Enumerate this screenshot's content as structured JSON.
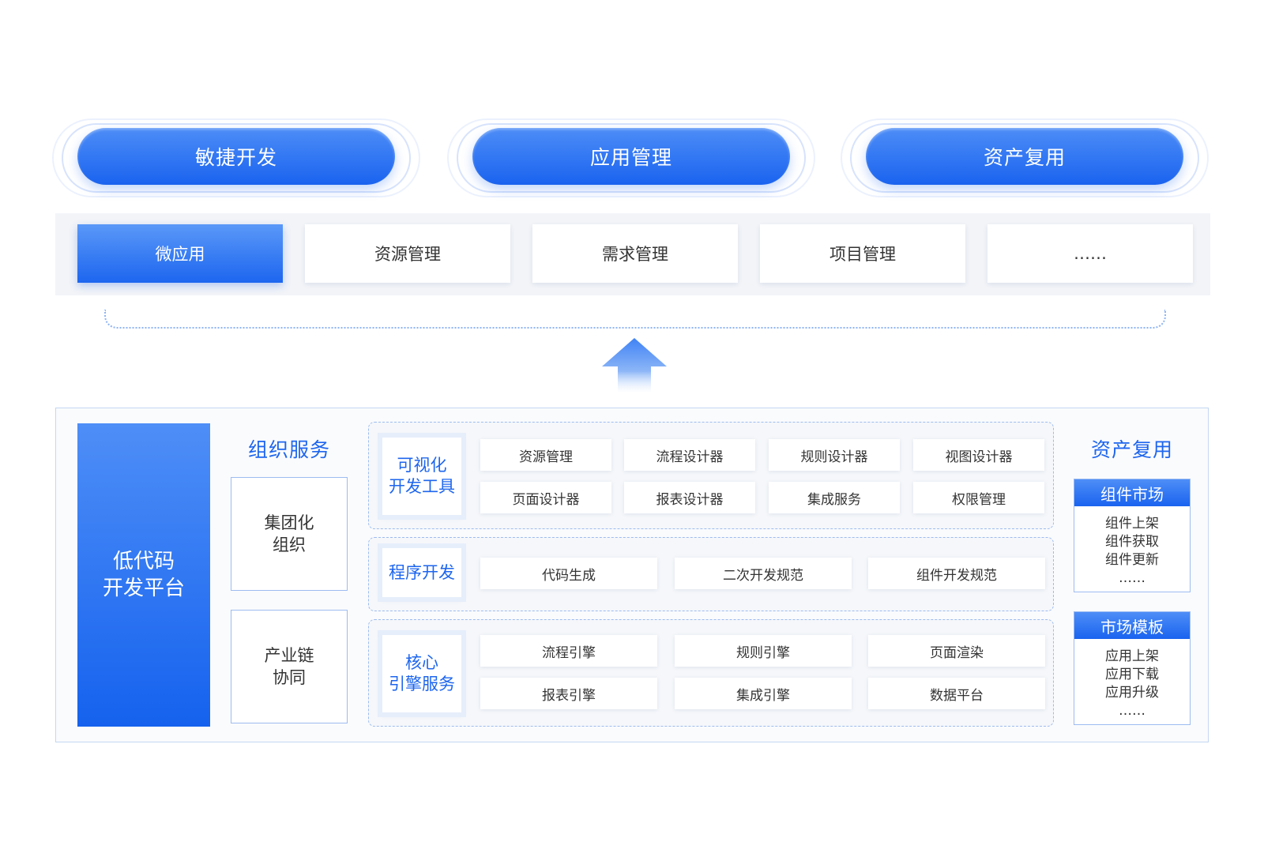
{
  "top_pills": [
    "敏捷开发",
    "应用管理",
    "资产复用"
  ],
  "tabs": [
    "微应用",
    "资源管理",
    "需求管理",
    "项目管理",
    "……"
  ],
  "platform": {
    "line1": "低代码",
    "line2": "开发平台"
  },
  "org_services": {
    "title": "组织服务",
    "boxes": [
      {
        "line1": "集团化",
        "line2": "组织"
      },
      {
        "line1": "产业链",
        "line2": "协同"
      }
    ]
  },
  "groups": {
    "visual": {
      "label1": "可视化",
      "label2": "开发工具",
      "items": [
        "资源管理",
        "流程设计器",
        "规则设计器",
        "视图设计器",
        "页面设计器",
        "报表设计器",
        "集成服务",
        "权限管理"
      ]
    },
    "program": {
      "label1": "程序开发",
      "items": [
        "代码生成",
        "二次开发规范",
        "组件开发规范"
      ]
    },
    "engine": {
      "label1": "核心",
      "label2": "引擎服务",
      "items": [
        "流程引擎",
        "规则引擎",
        "页面渲染",
        "报表引擎",
        "集成引擎",
        "数据平台"
      ]
    }
  },
  "asset_reuse": {
    "title": "资产复用",
    "cards": [
      {
        "title": "组件市场",
        "items": [
          "组件上架",
          "组件获取",
          "组件更新",
          "……"
        ]
      },
      {
        "title": "市场模板",
        "items": [
          "应用上架",
          "应用下载",
          "应用升级",
          "……"
        ]
      }
    ]
  },
  "colors": {
    "accent": "#1a63ef",
    "accent_light": "#4e8ef7",
    "border": "#9dbcf0",
    "panel_bg": "#f2f4f8"
  }
}
